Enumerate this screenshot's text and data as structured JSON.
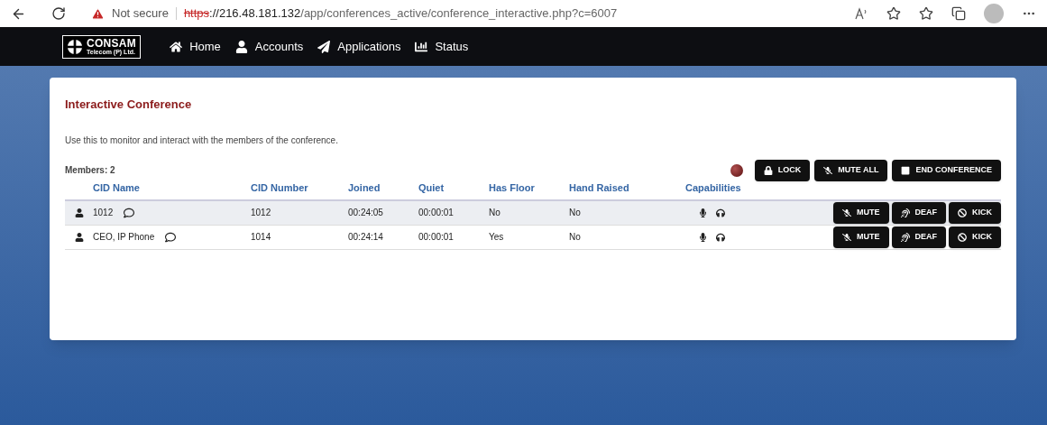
{
  "browser": {
    "security": "Not secure",
    "url_scheme": "https",
    "url_host": "://216.48.181.132",
    "url_path": "/app/conferences_active/conference_interactive.php?c=6007"
  },
  "nav": {
    "logo_title": "CONSAM",
    "logo_subtitle": "Telecom (P) Ltd.",
    "items": [
      {
        "label": "Home",
        "kind": "home"
      },
      {
        "label": "Accounts",
        "kind": "user"
      },
      {
        "label": "Applications",
        "kind": "send"
      },
      {
        "label": "Status",
        "kind": "chart"
      }
    ]
  },
  "card": {
    "title": "Interactive Conference",
    "description": "Use this to monitor and interact with the members of the conference.",
    "members": "Members: 2",
    "actions": [
      {
        "label": "LOCK",
        "kind": "lock"
      },
      {
        "label": "MUTE ALL",
        "kind": "mute"
      },
      {
        "label": "END CONFERENCE",
        "kind": "square"
      }
    ],
    "columns": [
      "CID Name",
      "CID Number",
      "Joined",
      "Quiet",
      "Has Floor",
      "Hand Raised",
      "Capabilities"
    ],
    "rows": [
      {
        "name": "1012",
        "number": "1012",
        "joined": "00:24:05",
        "quiet": "00:00:01",
        "has_floor": "No",
        "hand_raised": "No",
        "highlighted": true,
        "buttons": [
          {
            "label": "MUTE",
            "kind": "mute"
          },
          {
            "label": "DEAF",
            "kind": "deaf"
          },
          {
            "label": "KICK",
            "kind": "ban"
          }
        ]
      },
      {
        "name": "CEO, IP Phone",
        "number": "1014",
        "joined": "00:24:14",
        "quiet": "00:00:01",
        "has_floor": "Yes",
        "hand_raised": "No",
        "highlighted": false,
        "buttons": [
          {
            "label": "MUTE",
            "kind": "mute"
          },
          {
            "label": "DEAF",
            "kind": "deaf"
          },
          {
            "label": "KICK",
            "kind": "ban"
          }
        ]
      }
    ]
  }
}
